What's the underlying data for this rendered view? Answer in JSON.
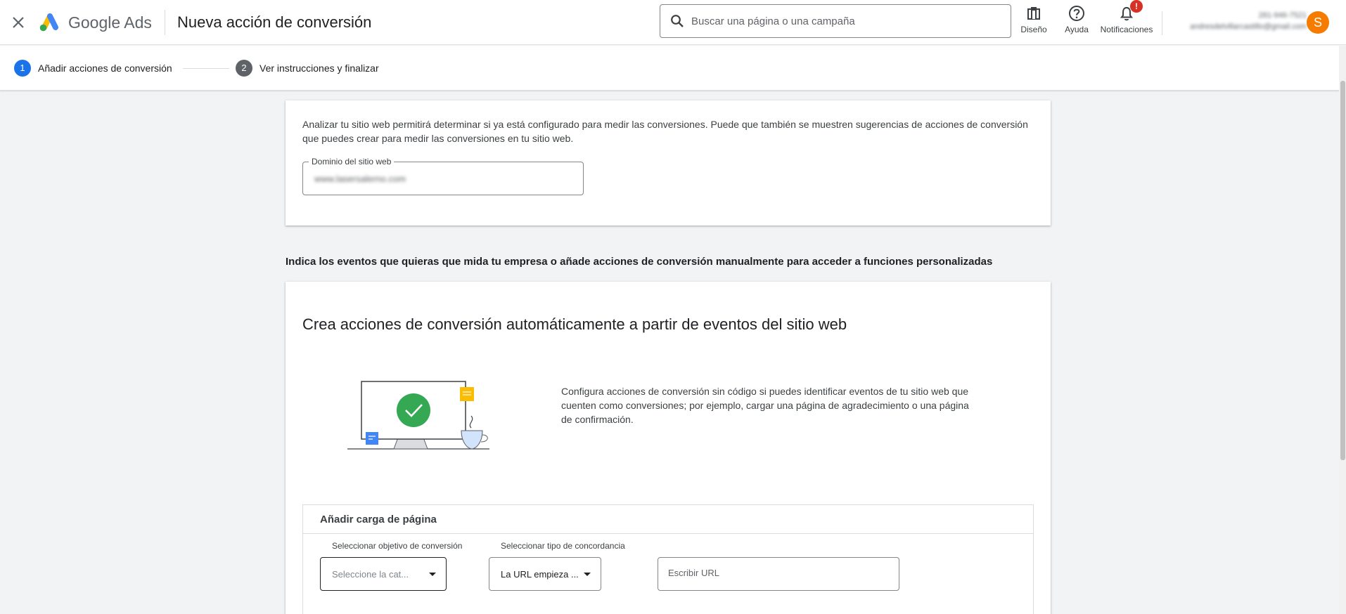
{
  "header": {
    "product_name": "Google Ads",
    "page_title": "Nueva acción de conversión",
    "search_placeholder": "Buscar una página o una campaña",
    "tools": {
      "design_label": "Diseño",
      "help_label": "Ayuda",
      "notifications_label": "Notificaciones",
      "notifications_badge": "!"
    },
    "account": {
      "id": "281-946-7521",
      "email": "andresdelvillarcastillo@gmail.com",
      "avatar_letter": "S",
      "avatar_color": "#f57c00"
    }
  },
  "stepper": {
    "steps": [
      {
        "number": "1",
        "label": "Añadir acciones de conversión",
        "active": true
      },
      {
        "number": "2",
        "label": "Ver instrucciones y finalizar",
        "active": false
      }
    ],
    "active_color": "#1a73e8",
    "inactive_color": "#5f6368"
  },
  "analyze_card": {
    "description": "Analizar tu sitio web permitirá determinar si ya está configurado para medir las conversiones. Puede que también se muestren sugerencias de acciones de conversión que puedes crear para medir las conversiones en tu sitio web.",
    "domain_label": "Dominio del sitio web",
    "domain_value": "www.lasersalerno.com"
  },
  "section_heading": "Indica los eventos que quieras que mida tu empresa o añade acciones de conversión manualmente para acceder a funciones personalizadas",
  "auto_card": {
    "title": "Crea acciones de conversión automáticamente a partir de eventos del sitio web",
    "description": "Configura acciones de conversión sin código si puedes identificar eventos de tu sitio web que cuenten como conversiones; por ejemplo, cargar una página de agradecimiento o una página de confirmación.",
    "page_load": {
      "title": "Añadir carga de página",
      "goal_label": "Seleccionar objetivo de conversión",
      "goal_placeholder": "Seleccione la cat...",
      "match_label": "Seleccionar tipo de concordancia",
      "match_value": "La URL empieza ...",
      "url_placeholder": "Escribir URL"
    }
  }
}
